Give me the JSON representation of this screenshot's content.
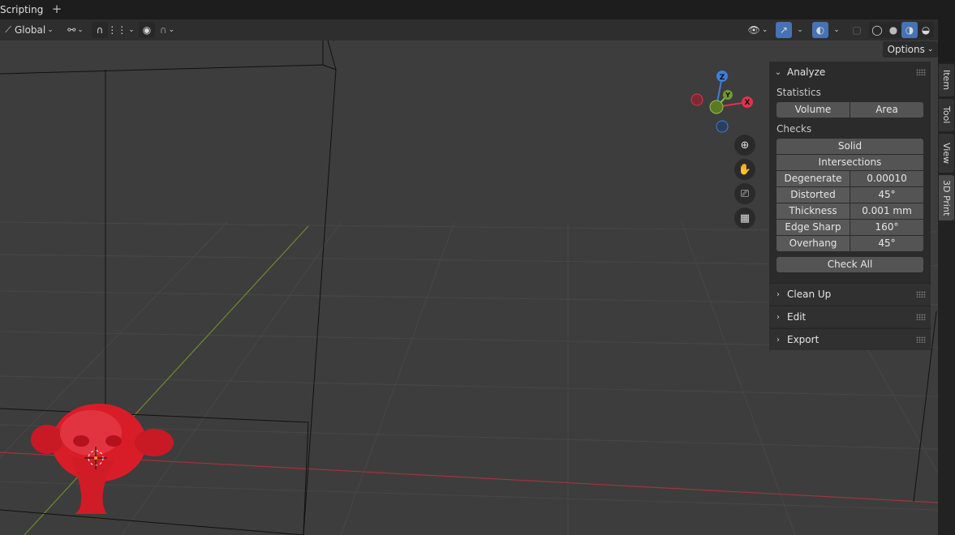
{
  "workspace": {
    "tab": "Scripting",
    "add": "+"
  },
  "header": {
    "orientation": "Global",
    "options": "Options"
  },
  "gizmo": {
    "z": "Z",
    "y": "Y",
    "x": "X"
  },
  "nav_icons": [
    "zoom-icon",
    "hand-pan-icon",
    "camera-icon",
    "grid-ortho-icon"
  ],
  "panel": {
    "title": "Analyze",
    "statistics_label": "Statistics",
    "volume": "Volume",
    "area": "Area",
    "checks_label": "Checks",
    "solid": "Solid",
    "intersections": "Intersections",
    "checks": [
      {
        "label": "Degenerate",
        "value": "0.00010"
      },
      {
        "label": "Distorted",
        "value": "45°"
      },
      {
        "label": "Thickness",
        "value": "0.001 mm"
      },
      {
        "label": "Edge Sharp",
        "value": "160°"
      },
      {
        "label": "Overhang",
        "value": "45°"
      }
    ],
    "check_all": "Check All",
    "collapsed": [
      "Clean Up",
      "Edit",
      "Export"
    ]
  },
  "side_tabs": [
    "Item",
    "Tool",
    "View",
    "3D Print"
  ],
  "colors": {
    "accent": "#4772b3",
    "mesh": "#e0202a",
    "x_axis": "#e0334a",
    "y_axis": "#8bc34a",
    "z_axis": "#3d7fd6"
  }
}
